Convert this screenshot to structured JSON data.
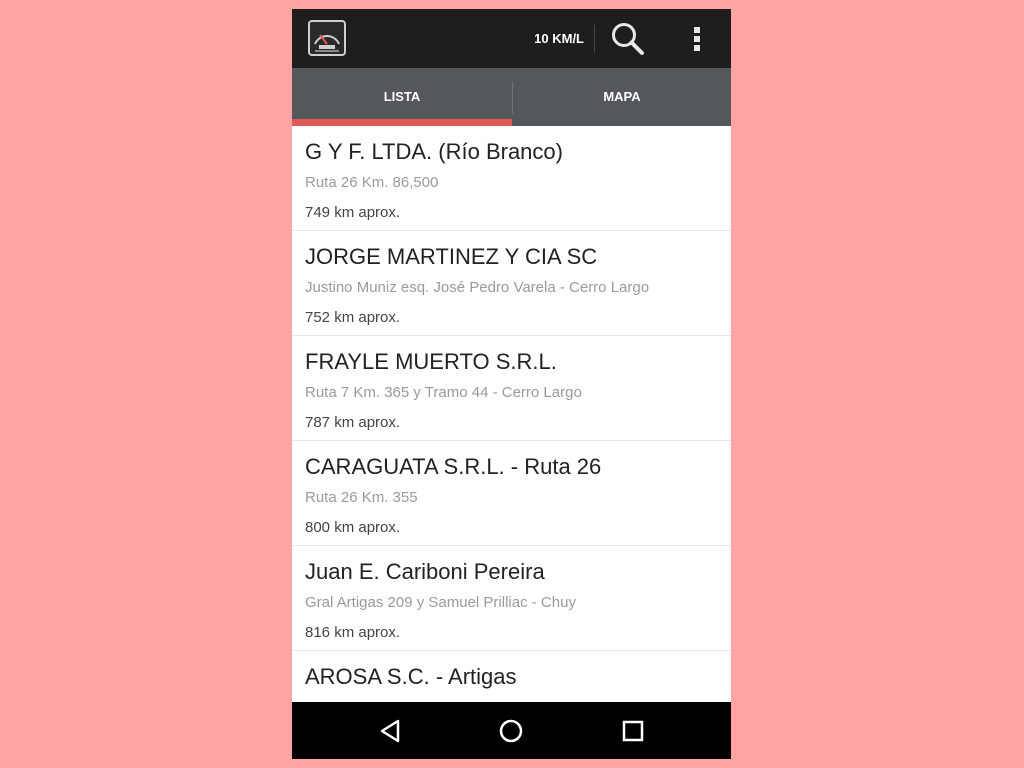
{
  "app": {
    "logo_icon": "fuel-gauge-logo-icon",
    "consumo_label": "10 KM/L",
    "search_icon": "search-icon",
    "menu_icon": "overflow-menu-icon"
  },
  "tabs": [
    {
      "label": "LISTA",
      "selected": true
    },
    {
      "label": "MAPA",
      "selected": false
    }
  ],
  "colors": {
    "background": "#ffa3a3",
    "appbar": "#1e1e1e",
    "tabbar": "#54585b",
    "tab_indicator": "#e05a5a"
  },
  "stations": [
    {
      "name": "G Y F. LTDA. (Río Branco)",
      "address": "Ruta 26 Km. 86,500",
      "distance": "749 km aprox."
    },
    {
      "name": "JORGE MARTINEZ Y CIA SC",
      "address": "Justino Muniz esq. José Pedro Varela - Cerro Largo",
      "distance": "752 km aprox."
    },
    {
      "name": "FRAYLE MUERTO S.R.L.",
      "address": "Ruta 7 Km. 365 y Tramo 44 - Cerro Largo",
      "distance": "787 km aprox."
    },
    {
      "name": "CARAGUATA S.R.L. - Ruta 26",
      "address": "Ruta 26 Km. 355",
      "distance": "800 km aprox."
    },
    {
      "name": "Juan E. Cariboni Pereira",
      "address": "Gral Artigas 209 y Samuel Prilliac - Chuy",
      "distance": "816 km aprox."
    },
    {
      "name": "AROSA S.C. - Artigas",
      "address": "",
      "distance": ""
    }
  ],
  "navbar": {
    "back_icon": "back-triangle-icon",
    "home_icon": "home-circle-icon",
    "recents_icon": "recents-square-icon"
  }
}
